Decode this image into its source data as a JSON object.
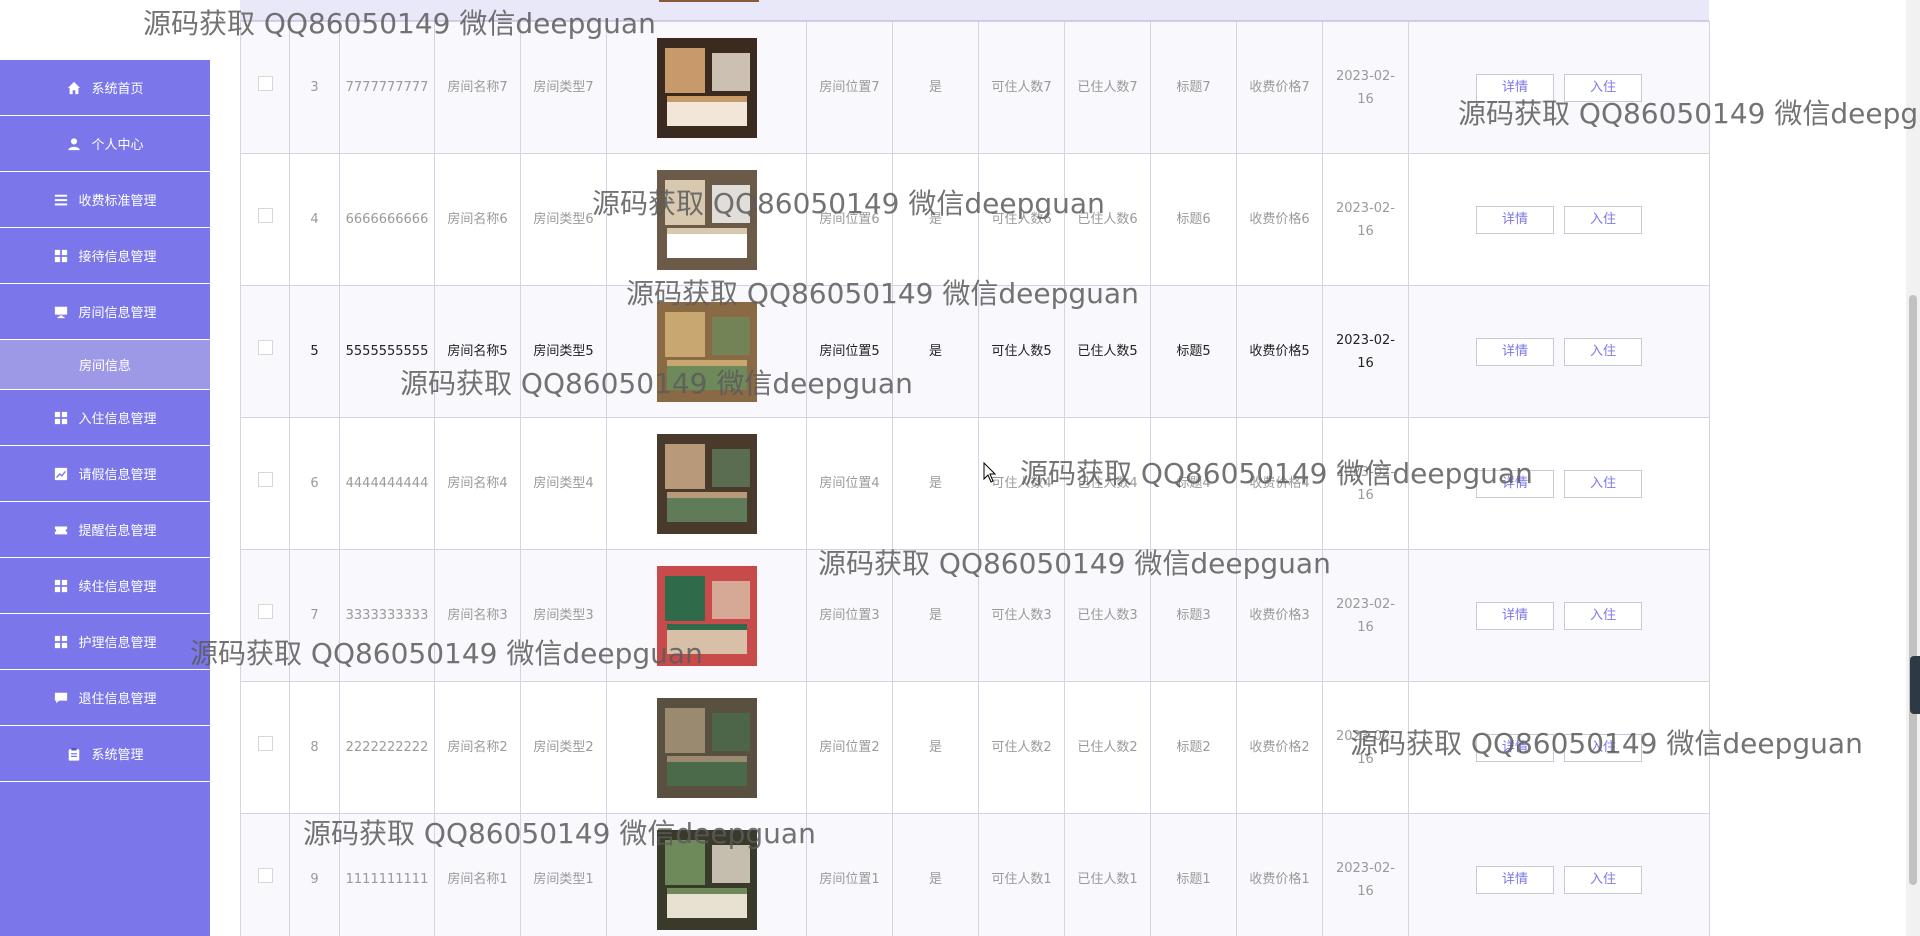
{
  "sidebar": {
    "items": [
      {
        "label": "系统首页",
        "icon": "home-icon"
      },
      {
        "label": "个人中心",
        "icon": "user-icon"
      },
      {
        "label": "收费标准管理",
        "icon": "list-icon"
      },
      {
        "label": "接待信息管理",
        "icon": "grid-icon"
      },
      {
        "label": "房间信息管理",
        "icon": "monitor-icon"
      }
    ],
    "active_sub": "房间信息",
    "items2": [
      {
        "label": "入住信息管理",
        "icon": "grid-icon"
      },
      {
        "label": "请假信息管理",
        "icon": "chart-icon"
      },
      {
        "label": "提醒信息管理",
        "icon": "ticket-icon"
      },
      {
        "label": "续住信息管理",
        "icon": "grid-icon"
      },
      {
        "label": "护理信息管理",
        "icon": "grid-icon"
      },
      {
        "label": "退住信息管理",
        "icon": "chat-icon"
      },
      {
        "label": "系统管理",
        "icon": "clipboard-icon"
      }
    ]
  },
  "table": {
    "detail_label": "详情",
    "checkin_label": "入住",
    "rows": [
      {
        "idx": "3",
        "no": "7777777777",
        "name": "房间名称7",
        "type": "房间类型7",
        "pos": "房间位置7",
        "flag": "是",
        "cap": "可住人数7",
        "occ": "已住人数7",
        "title": "标题7",
        "price": "收费价格7",
        "date": "2023-02-16",
        "photo": "room-photo-7"
      },
      {
        "idx": "4",
        "no": "6666666666",
        "name": "房间名称6",
        "type": "房间类型6",
        "pos": "房间位置6",
        "flag": "是",
        "cap": "可住人数6",
        "occ": "已住人数6",
        "title": "标题6",
        "price": "收费价格6",
        "date": "2023-02-16",
        "photo": "room-photo-6"
      },
      {
        "idx": "5",
        "no": "5555555555",
        "name": "房间名称5",
        "type": "房间类型5",
        "pos": "房间位置5",
        "flag": "是",
        "cap": "可住人数5",
        "occ": "已住人数5",
        "title": "标题5",
        "price": "收费价格5",
        "date": "2023-02-16",
        "photo": "room-photo-5"
      },
      {
        "idx": "6",
        "no": "4444444444",
        "name": "房间名称4",
        "type": "房间类型4",
        "pos": "房间位置4",
        "flag": "是",
        "cap": "可住人数4",
        "occ": "已住人数4",
        "title": "标题4",
        "price": "收费价格4",
        "date": "2023-02-16",
        "photo": "room-photo-4"
      },
      {
        "idx": "7",
        "no": "3333333333",
        "name": "房间名称3",
        "type": "房间类型3",
        "pos": "房间位置3",
        "flag": "是",
        "cap": "可住人数3",
        "occ": "已住人数3",
        "title": "标题3",
        "price": "收费价格3",
        "date": "2023-02-16",
        "photo": "room-photo-3"
      },
      {
        "idx": "8",
        "no": "2222222222",
        "name": "房间名称2",
        "type": "房间类型2",
        "pos": "房间位置2",
        "flag": "是",
        "cap": "可住人数2",
        "occ": "已住人数2",
        "title": "标题2",
        "price": "收费价格2",
        "date": "2023-02-16",
        "photo": "room-photo-2"
      },
      {
        "idx": "9",
        "no": "1111111111",
        "name": "房间名称1",
        "type": "房间类型1",
        "pos": "房间位置1",
        "flag": "是",
        "cap": "可住人数1",
        "occ": "已住人数1",
        "title": "标题1",
        "price": "收费价格1",
        "date": "2023-02-16",
        "photo": "room-photo-1"
      }
    ]
  },
  "watermark": "源码获取 QQ86050149 微信deepguan",
  "colors": {
    "sidebar": "#7b77ea",
    "sidebar_active": "#9d99e6",
    "accent": "#7b77ea"
  }
}
